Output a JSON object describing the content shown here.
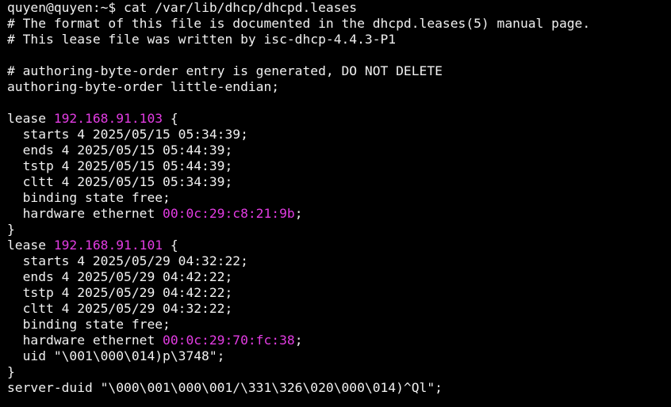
{
  "terminal": {
    "prompt": "quyen@quyen:~$ ",
    "command": "cat /var/lib/dhcp/dhcpd.leases",
    "header_comment_1": "# The format of this file is documented in the dhcpd.leases(5) manual page.",
    "header_comment_2": "# This lease file was written by isc-dhcp-4.4.3-P1",
    "authoring_comment": "# authoring-byte-order entry is generated, DO NOT DELETE",
    "authoring_line": "authoring-byte-order little-endian;",
    "leases": [
      {
        "keyword": "lease ",
        "ip": "192.168.91.103",
        "open": " {",
        "starts": "  starts 4 2025/05/15 05:34:39;",
        "ends": "  ends 4 2025/05/15 05:44:39;",
        "tstp": "  tstp 4 2025/05/15 05:44:39;",
        "cltt": "  cltt 4 2025/05/15 05:34:39;",
        "binding": "  binding state free;",
        "hardware_prefix": "  hardware ethernet ",
        "mac": "00:0c:29:c8:21:9b",
        "hardware_suffix": ";",
        "close": "}"
      },
      {
        "keyword": "lease ",
        "ip": "192.168.91.101",
        "open": " {",
        "starts": "  starts 4 2025/05/29 04:32:22;",
        "ends": "  ends 4 2025/05/29 04:42:22;",
        "tstp": "  tstp 4 2025/05/29 04:42:22;",
        "cltt": "  cltt 4 2025/05/29 04:32:22;",
        "binding": "  binding state free;",
        "hardware_prefix": "  hardware ethernet ",
        "mac": "00:0c:29:70:fc:38",
        "hardware_suffix": ";",
        "uid": "  uid \"\\001\\000\\014)p\\3748\";",
        "close": "}"
      }
    ],
    "server_duid": "server-duid \"\\000\\001\\000\\001/\\331\\326\\020\\000\\014)^Ql\";"
  },
  "colors": {
    "background": "#000000",
    "text": "#f0f0f0",
    "highlight": "#e23ce2"
  }
}
